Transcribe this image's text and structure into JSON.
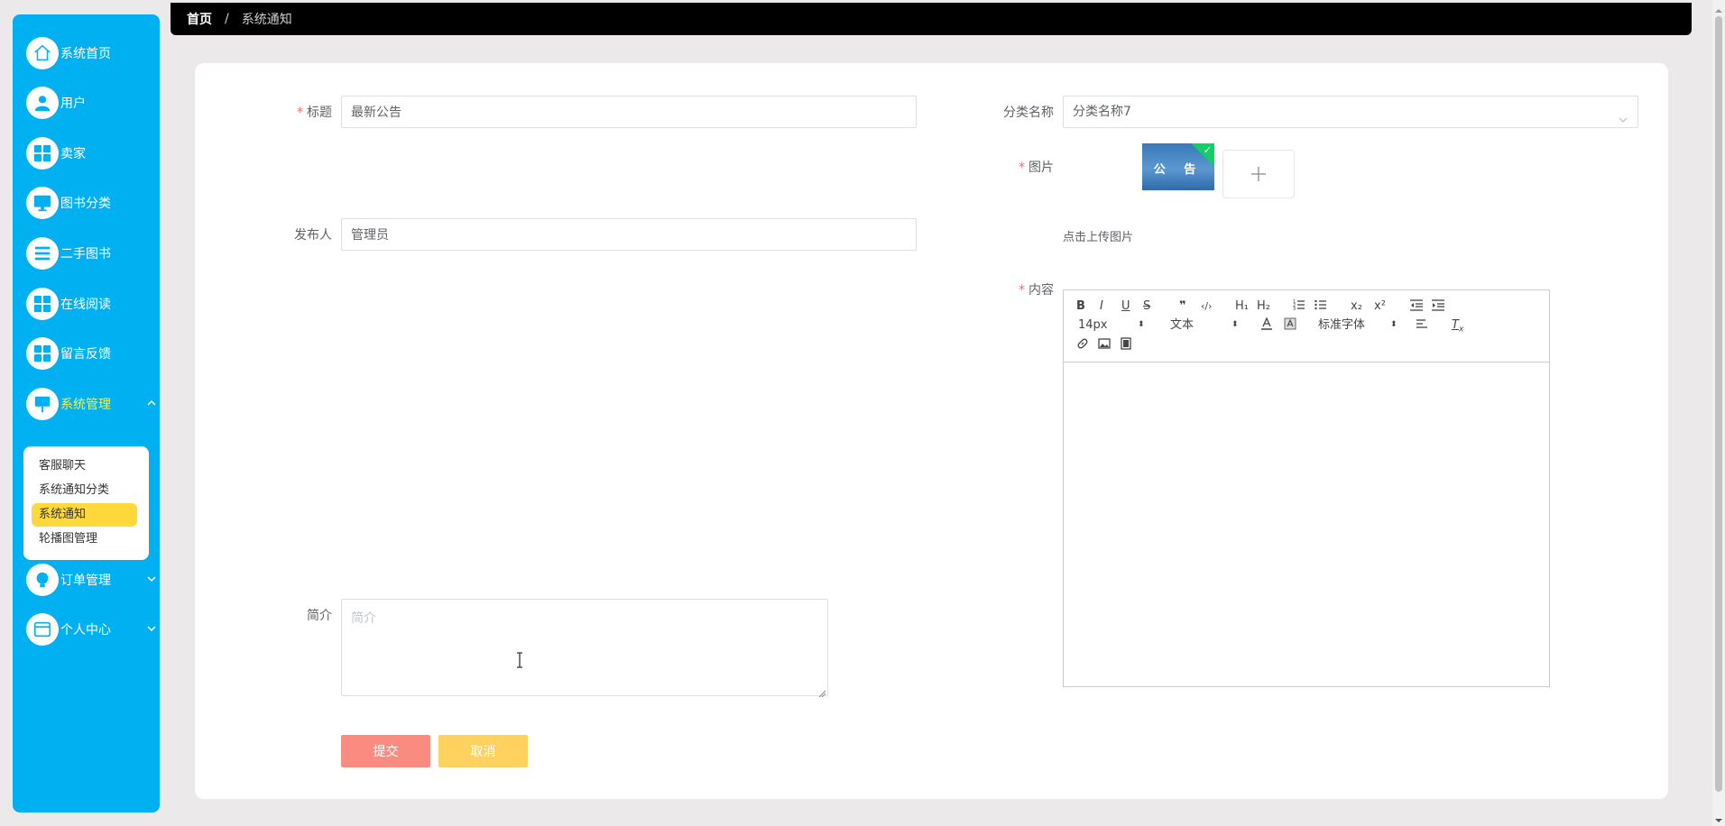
{
  "breadcrumb": {
    "home": "首页",
    "separator": "/",
    "current": "系统通知"
  },
  "sidebar": {
    "items": [
      {
        "label": "系统首页",
        "icon": "home-icon"
      },
      {
        "label": "用户",
        "icon": "user-icon"
      },
      {
        "label": "卖家",
        "icon": "grid-icon"
      },
      {
        "label": "图书分类",
        "icon": "monitor-icon"
      },
      {
        "label": "二手图书",
        "icon": "list-icon"
      },
      {
        "label": "在线阅读",
        "icon": "grid-icon"
      },
      {
        "label": "留言反馈",
        "icon": "grid-icon"
      },
      {
        "label": "系统管理",
        "icon": "sign-icon",
        "expanded": true
      },
      {
        "label": "订单管理",
        "icon": "bulb-icon"
      },
      {
        "label": "个人中心",
        "icon": "card-icon"
      }
    ],
    "submenu": [
      {
        "label": "客服聊天"
      },
      {
        "label": "系统通知分类"
      },
      {
        "label": "系统通知",
        "active": true
      },
      {
        "label": "轮播图管理"
      }
    ]
  },
  "form": {
    "title_label": "标题",
    "title_value": "最新公告",
    "category_label": "分类名称",
    "category_value": "分类名称7",
    "image_label": "图片",
    "image_thumb_text": "公 告",
    "upload_tip": "点击上传图片",
    "publisher_label": "发布人",
    "publisher_value": "管理员",
    "content_label": "内容",
    "intro_label": "简介",
    "intro_placeholder": "简介",
    "submit_label": "提交",
    "cancel_label": "取消"
  },
  "editor": {
    "bold": "B",
    "italic": "I",
    "underline": "U",
    "strike": "S",
    "quote": "❞",
    "code": "‹/›",
    "h1": "H₁",
    "h2": "H₂",
    "sub": "x₂",
    "sup": "x²",
    "font_size": "14px",
    "header_pick": "文本",
    "font_family": "标准字体",
    "clear": "T",
    "clear_sub": "x"
  },
  "colors": {
    "sidebar_bg": "#00b0f0",
    "active_menu_text": "#ffef3b",
    "active_submenu_bg": "#ffd93b",
    "submit_bg": "#fa8b80",
    "cancel_bg": "#ffd25f",
    "required": "#f56c6c"
  }
}
